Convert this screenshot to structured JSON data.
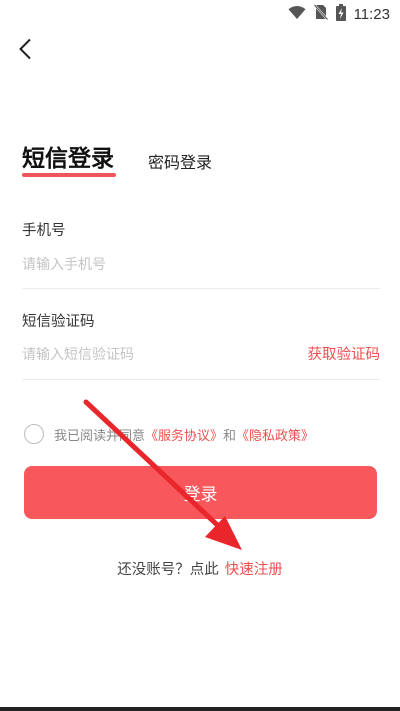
{
  "status_bar": {
    "time": "11:23",
    "icons": [
      "wifi-icon",
      "no-sim-icon",
      "battery-charging-icon"
    ]
  },
  "nav": {
    "back_icon": "chevron-left-icon"
  },
  "tabs": {
    "sms_login": "短信登录",
    "password_login": "密码登录"
  },
  "form": {
    "phone": {
      "label": "手机号",
      "placeholder": "请输入手机号",
      "value": ""
    },
    "code": {
      "label": "短信验证码",
      "placeholder": "请输入短信验证码",
      "value": "",
      "get_code_label": "获取验证码"
    }
  },
  "agreement": {
    "prefix": "我已阅读并同意",
    "service_link": "《服务协议》",
    "and": "和",
    "privacy_link": "《隐私政策》"
  },
  "login_button": {
    "label": "登录"
  },
  "register": {
    "prompt": "还没账号？点此",
    "link": "快速注册"
  },
  "colors": {
    "accent": "#f8575b",
    "link": "#ef4f4f",
    "annotation_arrow": "#e8262b"
  }
}
